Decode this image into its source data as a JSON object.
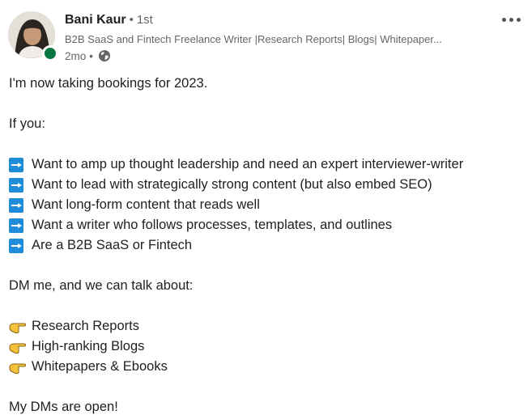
{
  "author": {
    "name": "Bani Kaur",
    "connection_degree": "1st",
    "headline": "B2B SaaS and Fintech Freelance Writer |Research Reports| Blogs| Whitepaper...",
    "time_posted": "2mo",
    "visibility_icon": "globe-icon",
    "online_status_color": "#057642"
  },
  "header": {
    "more_icon": "more-horizontal-icon"
  },
  "post": {
    "intro": "I'm now taking bookings for 2023.",
    "if_you": "If you:",
    "bullets_icon": "blue-right-arrow-emoji",
    "bullets": [
      "Want to amp up thought leadership and need an expert interviewer-writer",
      "Want to lead with strategically strong content (but also embed SEO)",
      "Want long-form content that reads well",
      "Want a writer who follows processes, templates, and outlines",
      "Are a B2B SaaS or Fintech"
    ],
    "dm_line": "DM me, and we can talk about:",
    "topics_icon": "pointing-hand-emoji",
    "topics": [
      "Research Reports",
      "High-ranking Blogs",
      "Whitepapers & Ebooks"
    ],
    "closing": "My DMs are open!"
  },
  "colors": {
    "arrow_emoji_bg": "#1e8cd9",
    "hand_emoji": "#f5c33b",
    "muted_text": "#666666"
  }
}
